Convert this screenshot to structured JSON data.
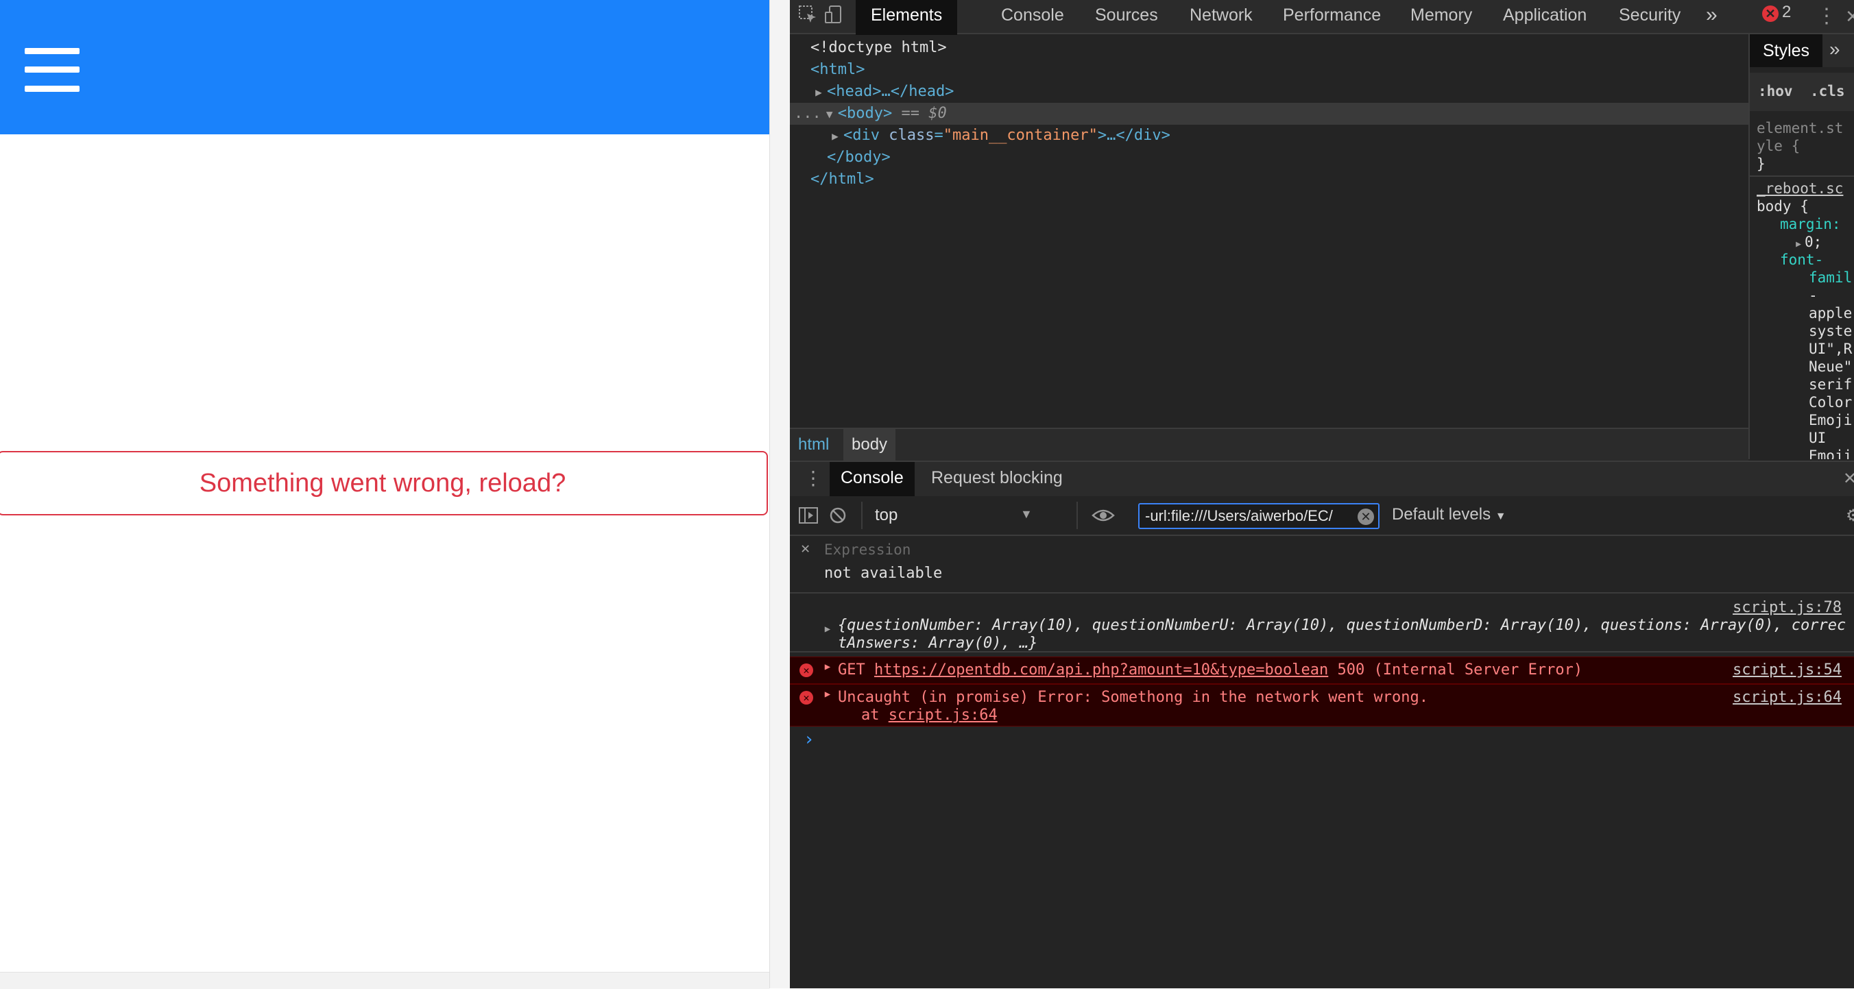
{
  "app": {
    "error_message": "Something went wrong, reload?",
    "header_color": "#1a82fb",
    "error_color": "#dc3545"
  },
  "devtools": {
    "tabs": [
      "Elements",
      "Console",
      "Sources",
      "Network",
      "Performance",
      "Memory",
      "Application",
      "Security"
    ],
    "active_tab": "Elements",
    "more_tabs_glyph": "»",
    "error_count": "2",
    "elements_tree": {
      "doctype": "<!doctype html>",
      "html_open": "<html>",
      "head": "<head>…</head>",
      "body_open": "<body>",
      "body_marker": "== $0",
      "div_open_tag": "<div ",
      "div_attr_name": "class",
      "div_attr_value": "\"main__container\"",
      "div_rest": ">…</div>",
      "div_eq": "=",
      "body_close": "</body>",
      "html_close": "</html>",
      "ellipsis": "..."
    },
    "breadcrumbs": [
      "html",
      "body"
    ],
    "styles": {
      "tab": "Styles",
      "hov": ":hov",
      "cls": ".cls",
      "element_style_1": "element.st",
      "element_style_2": "yle {",
      "close_brace": "}",
      "source_link": "_reboot.sc",
      "body_selector": "body {",
      "margin_prop": "margin:",
      "margin_val": "0;",
      "font_prop_1": "font-",
      "font_prop_2": "famil",
      "font_vals": [
        "-",
        "apple",
        "syste",
        "UI\",R",
        "Neue\"",
        "serif",
        "Color",
        "Emoji",
        "UI",
        "Emoji"
      ]
    },
    "drawer_tabs": [
      "Console",
      "Request blocking"
    ],
    "drawer_active": "Console",
    "console_toolbar": {
      "context": "top",
      "filter_value": "-url:file:///Users/aiwerbo/EC/",
      "levels": "Default levels"
    },
    "live_expression": {
      "placeholder": "Expression",
      "value": "not available"
    },
    "messages": {
      "log_source": "script.js:78",
      "log_line1": "{questionNumber: Array(10), questionNumberU: Array(10), questionNumberD: Array(10), questions: Array(0), correc",
      "log_line2": "tAnswers: Array(0), …}",
      "get_method": "GET ",
      "get_url": "https://opentdb.com/api.php?amount=10&type=boolean",
      "get_status": " 500 (Internal Server Error)",
      "get_source": "script.js:54",
      "uncaught_text": "Uncaught (in promise) Error: Somethong in the network went wrong.",
      "uncaught_at": "at ",
      "uncaught_at_link": "script.js:64",
      "uncaught_source": "script.js:64"
    },
    "prompt_glyph": "›"
  }
}
